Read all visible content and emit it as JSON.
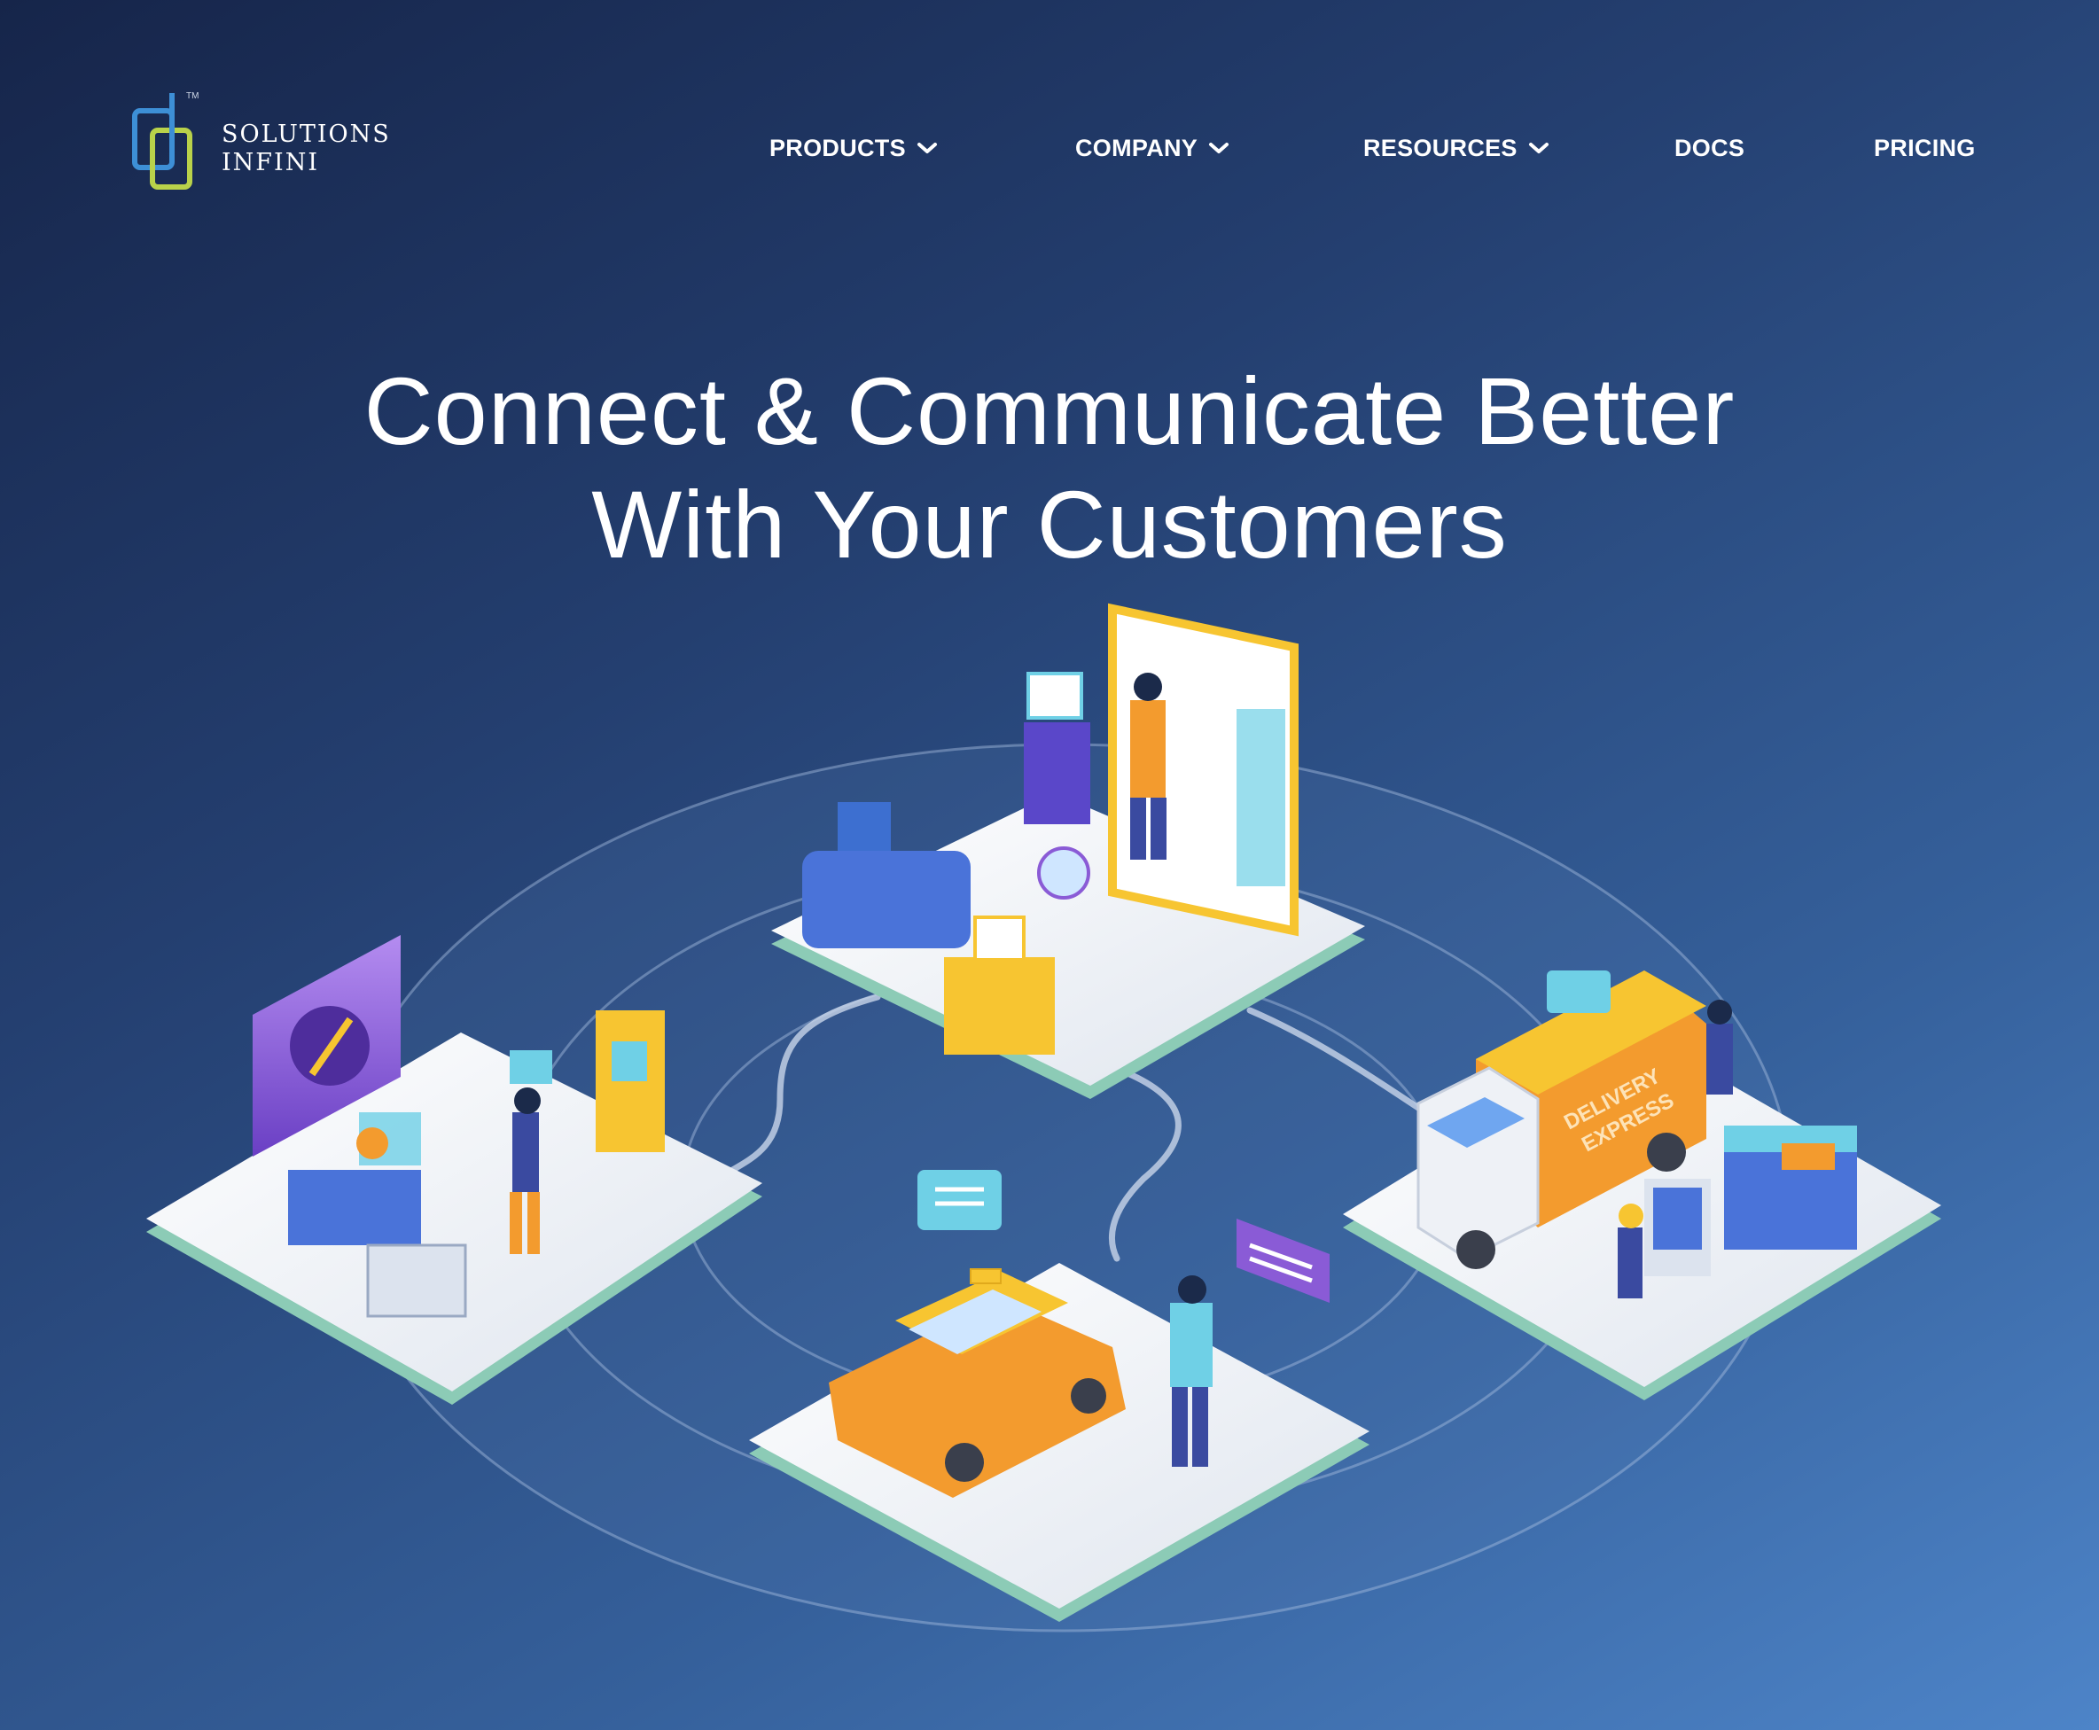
{
  "brand": {
    "line1": "SOLUTIONS",
    "line2": "INFINI",
    "tm": "TM",
    "colors": {
      "blue": "#3d8fd6",
      "green": "#b9d24a"
    }
  },
  "nav": {
    "products": "PRODUCTS",
    "company": "COMPANY",
    "resources": "RESOURCES",
    "docs": "DOCS",
    "pricing": "PRICING"
  },
  "hero": {
    "line1": "Connect & Communicate Better",
    "line2": "With Your Customers"
  },
  "illustration": {
    "truck_label_1": "DELIVERY",
    "truck_label_2": "EXPRESS",
    "colors": {
      "platform": "#eef1f6",
      "platform_edge": "#7fc4b0",
      "yellow": "#f7c531",
      "orange": "#f39b2e",
      "purple": "#8a5bd6",
      "blue": "#4a73d9",
      "teal": "#6fd0e6"
    }
  }
}
